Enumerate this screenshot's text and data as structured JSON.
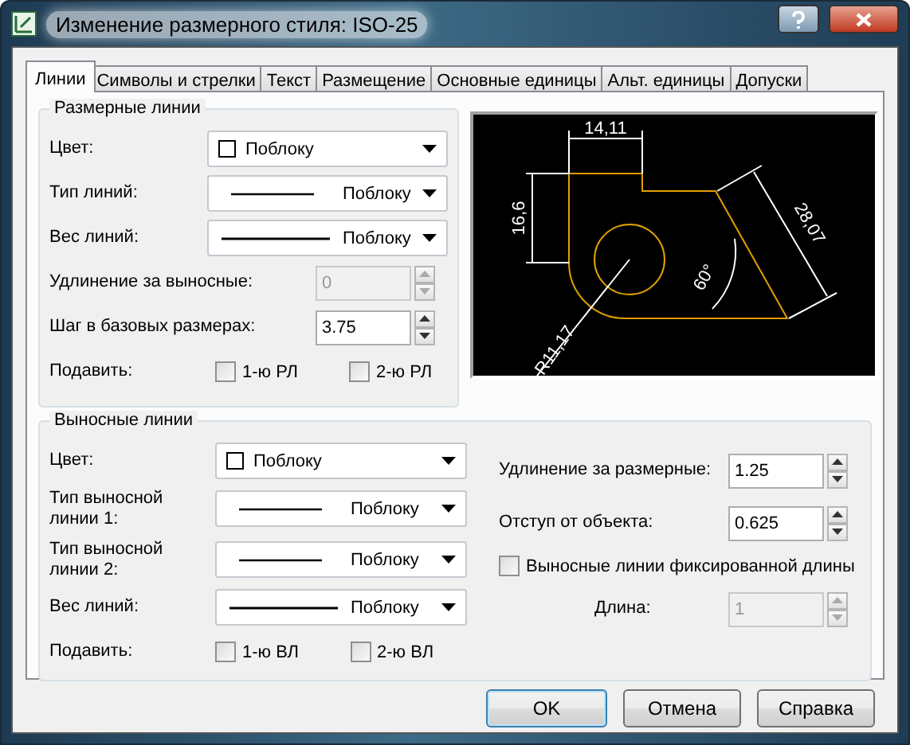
{
  "window": {
    "title": "Изменение размерного стиля: ISO-25"
  },
  "tabs": [
    {
      "label": "Линии",
      "selected": true
    },
    {
      "label": "Символы и стрелки",
      "selected": false
    },
    {
      "label": "Текст",
      "selected": false
    },
    {
      "label": "Размещение",
      "selected": false
    },
    {
      "label": "Основные единицы",
      "selected": false
    },
    {
      "label": "Альт. единицы",
      "selected": false
    },
    {
      "label": "Допуски",
      "selected": false
    }
  ],
  "dimension_lines": {
    "title": "Размерные линии",
    "fields": [
      {
        "kind": "color",
        "label": "Цвет:",
        "value": "Поблоку"
      },
      {
        "kind": "linetype",
        "label": "Тип линий:",
        "value": "Поблоку"
      },
      {
        "kind": "lineweight",
        "label": "Вес линий:",
        "value": "Поблоку"
      },
      {
        "kind": "spinner",
        "label": "Удлинение за выносные:",
        "value": "0",
        "disabled": true
      },
      {
        "kind": "spinner",
        "label": "Шаг в базовых размерах:",
        "value": "3.75",
        "disabled": false
      }
    ],
    "suppress": {
      "label": "Подавить:",
      "options": [
        {
          "label": "1-ю РЛ",
          "checked": false
        },
        {
          "label": "2-ю РЛ",
          "checked": false
        }
      ]
    }
  },
  "preview": {
    "labels": [
      "14,11",
      "16,6",
      "28,07",
      "60°",
      "R11,17"
    ]
  },
  "extension_lines": {
    "title": "Выносные линии",
    "fields": [
      {
        "kind": "color",
        "label": "Цвет:",
        "value": "Поблоку"
      },
      {
        "kind": "linetype",
        "label": "Тип выносной линии 1:",
        "value": "Поблоку"
      },
      {
        "kind": "linetype",
        "label": "Тип выносной линии 2:",
        "value": "Поблоку"
      },
      {
        "kind": "lineweight",
        "label": "Вес линий:",
        "value": "Поблоку"
      }
    ],
    "suppress": {
      "label": "Подавить:",
      "options": [
        {
          "label": "1-ю ВЛ",
          "checked": false
        },
        {
          "label": "2-ю ВЛ",
          "checked": false
        }
      ]
    },
    "right_fields": [
      {
        "kind": "spinner",
        "label": "Удлинение за размерные:",
        "value": "1.25",
        "disabled": false
      },
      {
        "kind": "spinner",
        "label": "Отступ от объекта:",
        "value": "0.625",
        "disabled": false
      },
      {
        "kind": "checkbox",
        "label": "Выносные линии фиксированной длины",
        "checked": false
      },
      {
        "kind": "spinner",
        "label": "Длина:",
        "value": "1",
        "disabled": true,
        "indent": true
      }
    ]
  },
  "buttons": [
    {
      "label": "OK",
      "default": true
    },
    {
      "label": "Отмена",
      "default": false
    },
    {
      "label": "Справка",
      "default": false
    }
  ]
}
